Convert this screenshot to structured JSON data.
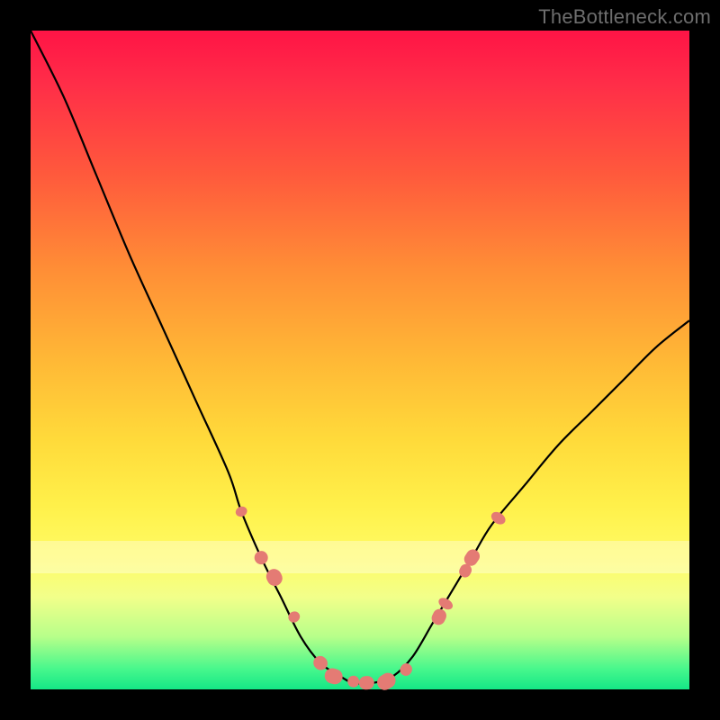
{
  "watermark": "TheBottleneck.com",
  "chart_data": {
    "type": "line",
    "title": "",
    "xlabel": "",
    "ylabel": "",
    "xlim": [
      0,
      1
    ],
    "ylim": [
      0,
      1
    ],
    "series": [
      {
        "name": "curve",
        "x": [
          0.0,
          0.05,
          0.1,
          0.15,
          0.2,
          0.25,
          0.3,
          0.32,
          0.35,
          0.38,
          0.41,
          0.44,
          0.47,
          0.49,
          0.52,
          0.55,
          0.58,
          0.61,
          0.64,
          0.67,
          0.7,
          0.75,
          0.8,
          0.85,
          0.9,
          0.95,
          1.0
        ],
        "y": [
          1.0,
          0.9,
          0.78,
          0.66,
          0.55,
          0.44,
          0.33,
          0.27,
          0.2,
          0.14,
          0.08,
          0.04,
          0.02,
          0.01,
          0.01,
          0.02,
          0.05,
          0.1,
          0.15,
          0.2,
          0.25,
          0.31,
          0.37,
          0.42,
          0.47,
          0.52,
          0.56
        ]
      }
    ],
    "markers": {
      "name": "salmon-dots",
      "color": "#e47b74",
      "x": [
        0.32,
        0.35,
        0.37,
        0.4,
        0.44,
        0.46,
        0.49,
        0.51,
        0.54,
        0.57,
        0.62,
        0.63,
        0.66,
        0.67,
        0.71
      ],
      "y": [
        0.27,
        0.2,
        0.17,
        0.11,
        0.04,
        0.02,
        0.012,
        0.01,
        0.012,
        0.03,
        0.11,
        0.13,
        0.18,
        0.2,
        0.26
      ]
    },
    "annotations": {
      "horizontal_band_y": 0.19
    }
  }
}
